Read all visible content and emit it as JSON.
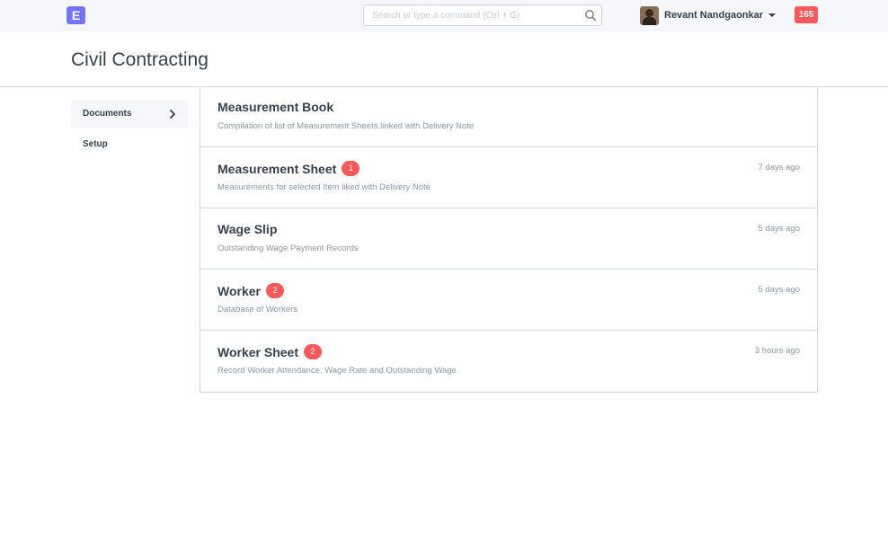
{
  "navbar": {
    "logo_letter": "E",
    "search_placeholder": "Search or type a command (Ctrl + G)",
    "user_name": "Revant Nandgaonkar",
    "notification_count": "165"
  },
  "page": {
    "title": "Civil Contracting"
  },
  "sidebar": {
    "items": [
      {
        "label": "Documents"
      },
      {
        "label": "Setup"
      }
    ]
  },
  "list": {
    "items": [
      {
        "title": "Measurement Book",
        "description": "Compilation of list of Measurement Sheets linked with Delivery Note",
        "badge": "",
        "time": ""
      },
      {
        "title": "Measurement Sheet",
        "description": "Measurements for selected Item liked with Delivery Note",
        "badge": "1",
        "time": "7 days ago"
      },
      {
        "title": "Wage Slip",
        "description": "Outstanding Wage Payment Records",
        "badge": "",
        "time": "5 days ago"
      },
      {
        "title": "Worker",
        "description": "Database of Workers",
        "badge": "2",
        "time": "5 days ago"
      },
      {
        "title": "Worker Sheet",
        "description": "Record Worker Attendance, Wage Rate and Outstanding Wage",
        "badge": "2",
        "time": "3 hours ago"
      }
    ]
  },
  "colors": {
    "brand": "#7574ff",
    "badge": "#ff5858",
    "text": "#36414c",
    "muted": "#8d99a6",
    "border": "#d1d8dd",
    "navbar_bg": "#f5f7fa"
  }
}
